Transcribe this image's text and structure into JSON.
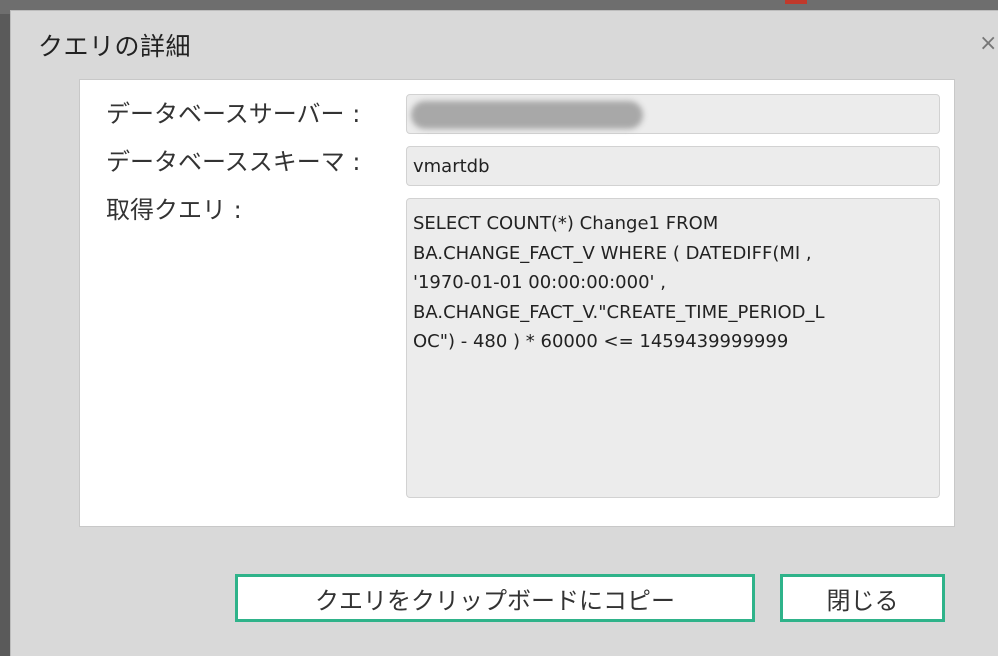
{
  "dialog": {
    "title": "クエリの詳細",
    "close_icon": "×"
  },
  "fields": {
    "server": {
      "label": "データベースサーバー :",
      "value": ""
    },
    "schema": {
      "label": "データベーススキーマ :",
      "value": "vmartdb"
    },
    "query": {
      "label": "取得クエリ :",
      "lines": [
        "SELECT COUNT(*) Change1 FROM",
        "BA.CHANGE_FACT_V  WHERE ( DATEDIFF(MI ,",
        "'1970-01-01 00:00:00:000' ,",
        "BA.CHANGE_FACT_V.\"CREATE_TIME_PERIOD_L",
        "OC\") - 480 ) * 60000 <= 1459439999999"
      ]
    }
  },
  "buttons": {
    "copy_label": "クエリをクリップボードにコピー",
    "close_label": "閉じる"
  },
  "colors": {
    "button_border": "#2fb38a",
    "dialog_bg": "#d9d9d9",
    "field_bg": "#ececec"
  },
  "icons": {
    "close": "close-icon"
  }
}
